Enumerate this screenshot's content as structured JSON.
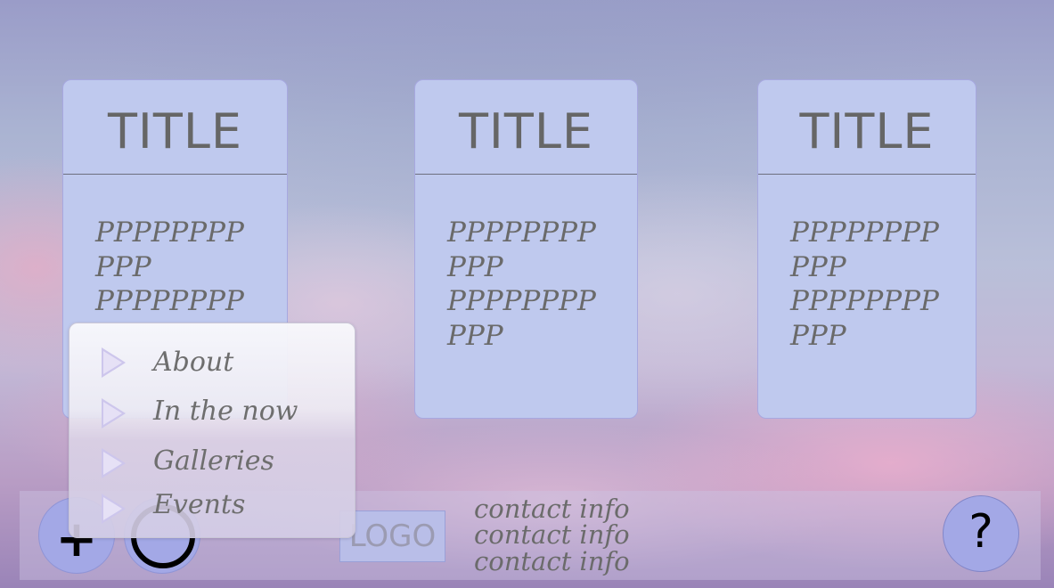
{
  "cards": [
    {
      "title": "TITLE",
      "lines": [
        "PPPPPPPP",
        "PPP",
        "PPPPPPPP"
      ]
    },
    {
      "title": "TITLE",
      "lines": [
        "PPPPPPPP",
        "PPP",
        "PPPPPPPP",
        "PPP"
      ]
    },
    {
      "title": "TITLE",
      "lines": [
        "PPPPPPPP",
        "PPP",
        "PPPPPPPP",
        "PPP"
      ]
    }
  ],
  "menu": {
    "items": [
      {
        "label": "About",
        "icon": "play-triangle-icon"
      },
      {
        "label": "In the now",
        "icon": "play-triangle-icon"
      },
      {
        "label": "Galleries",
        "icon": "play-triangle-icon"
      },
      {
        "label": "Events",
        "icon": "play-triangle-icon"
      }
    ]
  },
  "footer": {
    "plus_button": {
      "glyph": "+",
      "icon": "plus-icon"
    },
    "circle_button": {
      "icon": "circle-icon"
    },
    "logo": "LOGO",
    "contact": [
      "contact info",
      "contact info",
      "contact info"
    ],
    "help_button": {
      "glyph": "?",
      "icon": "question-icon"
    }
  },
  "colors": {
    "card_background": "#bfc9ee",
    "button_fill": "#a3a8e6",
    "text_gray": "#666666",
    "menu_arrow": "#cdc6ec"
  }
}
